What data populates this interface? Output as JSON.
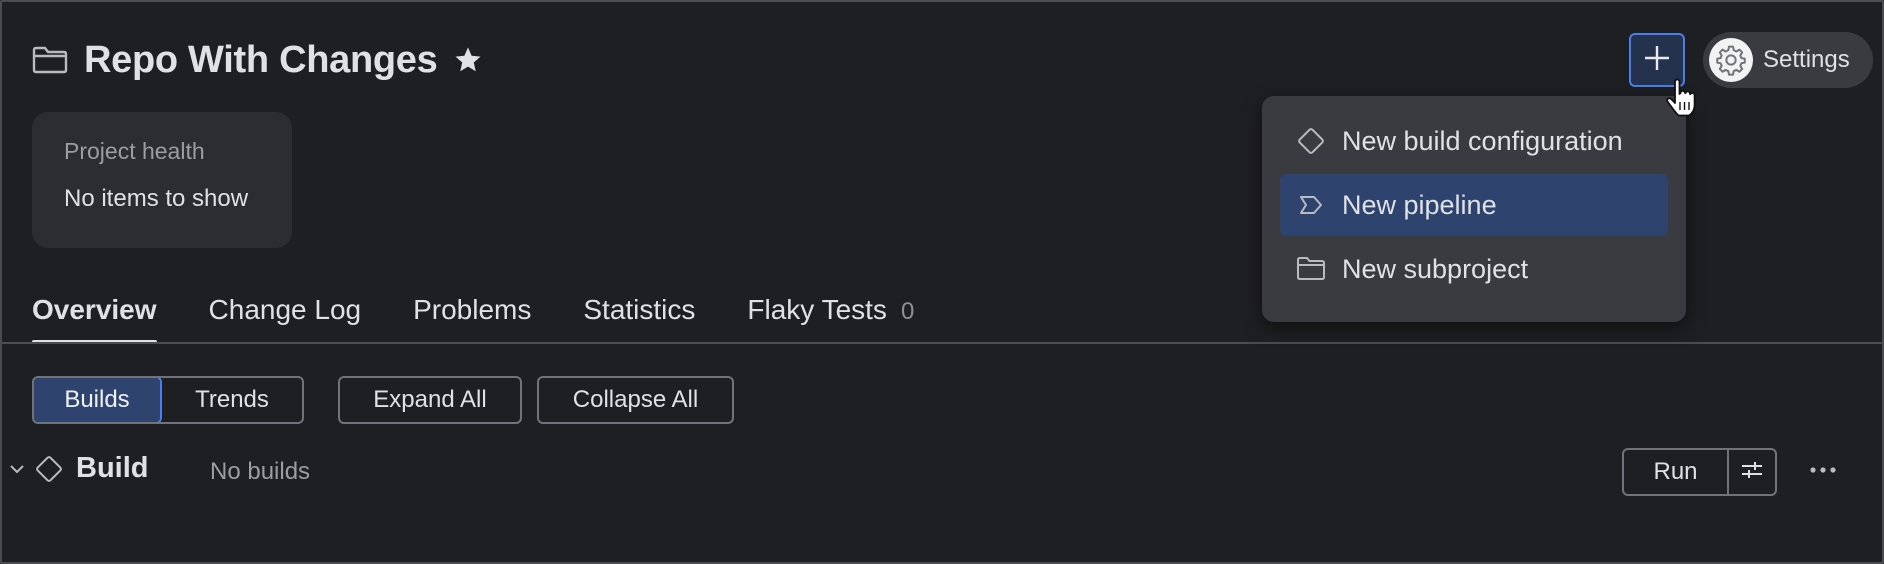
{
  "project": {
    "title": "Repo With Changes",
    "icon": "folder-icon",
    "favorite_icon": "star-icon"
  },
  "toolbar": {
    "add_icon": "plus-icon",
    "settings_label": "Settings",
    "settings_icon": "gear-icon"
  },
  "add_menu": {
    "items": [
      {
        "label": "New build configuration",
        "icon": "diamond-icon",
        "selected": false
      },
      {
        "label": "New pipeline",
        "icon": "pipeline-icon",
        "selected": true
      },
      {
        "label": "New subproject",
        "icon": "folder-icon",
        "selected": false
      }
    ]
  },
  "health": {
    "title": "Project health",
    "value": "No items to show"
  },
  "tabs": [
    {
      "label": "Overview",
      "active": true
    },
    {
      "label": "Change Log",
      "active": false
    },
    {
      "label": "Problems",
      "active": false
    },
    {
      "label": "Statistics",
      "active": false
    },
    {
      "label": "Flaky Tests",
      "active": false,
      "count": "0"
    }
  ],
  "view_toggle": {
    "builds_label": "Builds",
    "trends_label": "Trends",
    "selected": "Builds"
  },
  "actions": {
    "expand_label": "Expand All",
    "collapse_label": "Collapse All"
  },
  "build_config": {
    "name": "Build",
    "status": "No builds",
    "run_label": "Run",
    "options_icon": "run-options-icon",
    "more_icon": "more-horizontal-icon"
  },
  "colors": {
    "background": "#1e1f22",
    "accent": "#4a7ee8",
    "selected": "#2e436e",
    "menu_bg": "#393b40"
  }
}
